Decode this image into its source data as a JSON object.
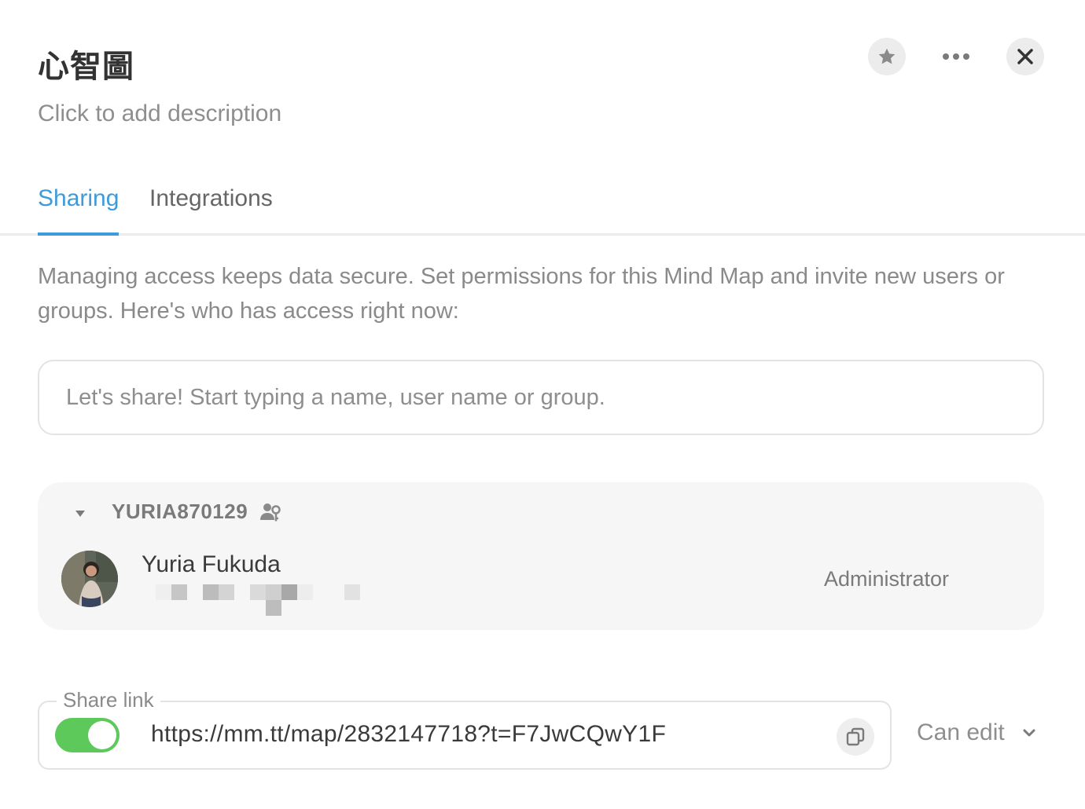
{
  "header": {
    "title": "心智圖",
    "description_placeholder": "Click to add description"
  },
  "tabs": [
    {
      "label": "Sharing",
      "active": true
    },
    {
      "label": "Integrations",
      "active": false
    }
  ],
  "sharing": {
    "info_text": "Managing access keeps data secure. Set permissions for this Mind Map and invite new users or groups. Here's who has access right now:",
    "search_placeholder": "Let's share! Start typing a name, user name or group.",
    "group": {
      "name": "YURIA870129",
      "members": [
        {
          "name": "Yuria Fukuda",
          "role": "Administrator"
        }
      ]
    },
    "share_link": {
      "legend": "Share link",
      "enabled": true,
      "url": "https://mm.tt/map/2832147718?t=F7JwCQwY1F",
      "permission": "Can edit"
    }
  },
  "colors": {
    "accent": "#3d9bdb",
    "toggle_on": "#5cc95a"
  }
}
